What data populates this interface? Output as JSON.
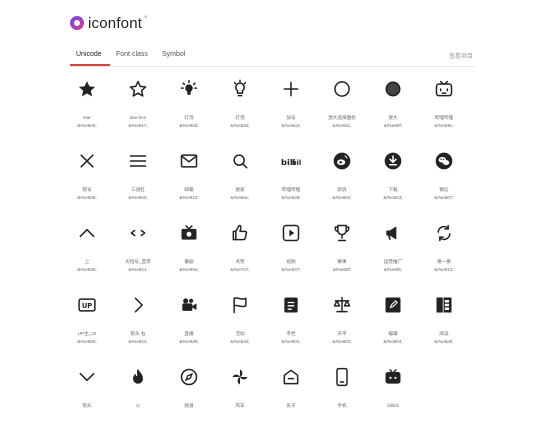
{
  "header": {
    "logo_text": "iconfont",
    "logo_mark": "*"
  },
  "tabs": [
    {
      "label": "Unicode",
      "active": true
    },
    {
      "label": "Font class",
      "active": false
    },
    {
      "label": "Symbol",
      "active": false
    }
  ],
  "view_project_label": "查看项目",
  "icons": [
    {
      "icon": "star-filled-icon",
      "name": "star",
      "code": "&#xe6e5;"
    },
    {
      "icon": "star-line-icon",
      "name": "star-line",
      "code": "&#xe617;"
    },
    {
      "icon": "bulb-on-icon",
      "name": "灯泡",
      "code": "&#xe60d;"
    },
    {
      "icon": "bulb-off-icon",
      "name": "灯泡",
      "code": "&#xe63d;"
    },
    {
      "icon": "plus-icon",
      "name": "加号",
      "code": "&#xe6a3;"
    },
    {
      "icon": "circle-outline-icon",
      "name": "放大选择图标",
      "code": "&#xe6bc;"
    },
    {
      "icon": "circle-dark-icon",
      "name": "放大",
      "code": "&#xe69f;"
    },
    {
      "icon": "bilibili-tv-icon",
      "name": "哔哩哔哩",
      "code": "&#xe69c;"
    },
    {
      "icon": "close-icon",
      "name": "错号",
      "code": "&#xe606;"
    },
    {
      "icon": "menu-icon",
      "name": "三道杠",
      "code": "&#xe660;"
    },
    {
      "icon": "mail-icon",
      "name": "邮箱",
      "code": "&#xe610;"
    },
    {
      "icon": "search-icon",
      "name": "搜索",
      "code": "&#xe6ac;"
    },
    {
      "icon": "bilibili-logo-icon",
      "name": "哔哩哔哩",
      "code": "&#xe628;"
    },
    {
      "icon": "weibo-icon",
      "name": "新浪",
      "code": "&#xe60e;"
    },
    {
      "icon": "download-icon",
      "name": "下载",
      "code": "&#xe623;"
    },
    {
      "icon": "wechat-icon",
      "name": "微信",
      "code": "&#xe607;"
    },
    {
      "icon": "chevron-up-icon",
      "name": "上",
      "code": "&#xe638;"
    },
    {
      "icon": "code-brackets-icon",
      "name": "尖括号_首页",
      "code": "&#xe621;"
    },
    {
      "icon": "tv-camera-icon",
      "name": "番剧",
      "code": "&#xe60a;"
    },
    {
      "icon": "thumbs-up-icon",
      "name": "点赞",
      "code": "&#xe7a7;"
    },
    {
      "icon": "video-play-icon",
      "name": "视频",
      "code": "&#xe637;"
    },
    {
      "icon": "trophy-icon",
      "name": "赛事",
      "code": "&#xe65f;"
    },
    {
      "icon": "megaphone-icon",
      "name": "运营推广",
      "code": "&#xe6f5;"
    },
    {
      "icon": "refresh-icon",
      "name": "换一换",
      "code": "&#xe612;"
    },
    {
      "icon": "up-badge-icon",
      "name": "UP主_32",
      "code": "&#xe665;"
    },
    {
      "icon": "chevron-right-icon",
      "name": "箭头 右",
      "code": "&#xe624;"
    },
    {
      "icon": "live-camera-icon",
      "name": "直播",
      "code": "&#xe6d9;"
    },
    {
      "icon": "flag-icon",
      "name": "活动",
      "code": "&#xe64d;"
    },
    {
      "icon": "article-icon",
      "name": "专栏",
      "code": "&#xe602;"
    },
    {
      "icon": "scale-icon",
      "name": "天平",
      "code": "&#xe603;"
    },
    {
      "icon": "edit-box-icon",
      "name": "编辑",
      "code": "&#xe604;"
    },
    {
      "icon": "book-icon",
      "name": "阅读",
      "code": "&#xe6ab;"
    },
    {
      "icon": "chevron-down-icon",
      "name": "箭头",
      "code": ""
    },
    {
      "icon": "fire-icon",
      "name": "火",
      "code": ""
    },
    {
      "icon": "compass-icon",
      "name": "频道",
      "code": ""
    },
    {
      "icon": "pinwheel-icon",
      "name": "风车",
      "code": ""
    },
    {
      "icon": "home-icon",
      "name": "房子",
      "code": ""
    },
    {
      "icon": "phone-icon",
      "name": "手机",
      "code": ""
    },
    {
      "icon": "bilibili-small-icon",
      "name": "bilibili",
      "code": ""
    }
  ]
}
